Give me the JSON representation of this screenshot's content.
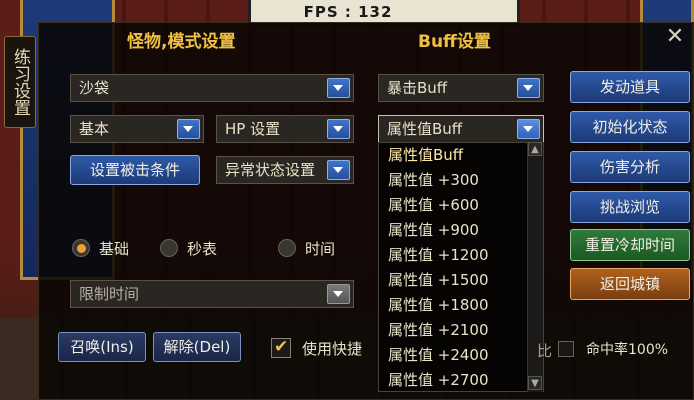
{
  "fps": "FPS : 132",
  "side_tab": "练习设置",
  "monster_panel": {
    "title": "怪物,模式设置",
    "monster_select": "沙袋",
    "type_select": "基本",
    "hp_select": "HP 设置",
    "hit_condition_button": "设置被击条件",
    "abnormal_select": "异常状态设置",
    "radios": [
      {
        "label": "基础",
        "checked": true
      },
      {
        "label": "秒表",
        "checked": false
      },
      {
        "label": "时间",
        "checked": false
      }
    ],
    "time_limit_select": "限制时间",
    "summon_button": "召唤(Ins)",
    "dismiss_button": "解除(Del)",
    "quick_use_label": "使用快捷",
    "quick_use_checked": true
  },
  "buff_panel": {
    "title": "Buff设置",
    "crit_select": "暴击Buff",
    "attr_select": "属性值Buff",
    "dropdown_options": [
      "属性值Buff",
      "属性值 +300",
      "属性值 +600",
      "属性值 +900",
      "属性值 +1200",
      "属性值 +1500",
      "属性值 +1800",
      "属性值 +2100",
      "属性值 +2400",
      "属性值 +2700"
    ],
    "hit_rate_label": "命中率100%",
    "hit_rate_prefix": "比"
  },
  "right_buttons": [
    {
      "label": "发动道具",
      "style": "blue"
    },
    {
      "label": "初始化状态",
      "style": "blue"
    },
    {
      "label": "伤害分析",
      "style": "blue"
    },
    {
      "label": "挑战浏览",
      "style": "blue"
    },
    {
      "label": "重置冷却时间",
      "style": "green"
    },
    {
      "label": "返回城镇",
      "style": "orange"
    }
  ],
  "close_icon": "close-icon"
}
